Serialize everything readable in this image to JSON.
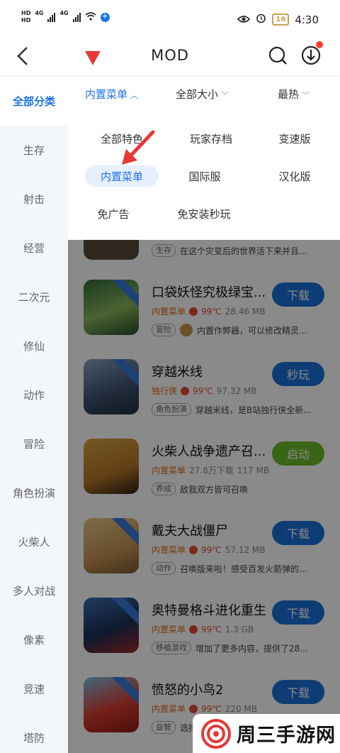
{
  "status_bar": {
    "hd_top": "HD",
    "hd_bottom": "HD",
    "net1": "4G",
    "net2": "4G",
    "net_sub1": "1",
    "net_sub2": "2",
    "battery": "16",
    "time": "4:30"
  },
  "header": {
    "title": "MOD"
  },
  "sidebar": {
    "items": [
      {
        "label": "全部分类",
        "active": true
      },
      {
        "label": "生存"
      },
      {
        "label": "射击"
      },
      {
        "label": "经营"
      },
      {
        "label": "二次元"
      },
      {
        "label": "修仙"
      },
      {
        "label": "动作"
      },
      {
        "label": "冒险"
      },
      {
        "label": "角色扮演"
      },
      {
        "label": "火柴人"
      },
      {
        "label": "多人对战"
      },
      {
        "label": "像素"
      },
      {
        "label": "竞速"
      },
      {
        "label": "塔防"
      }
    ]
  },
  "filters": [
    {
      "label": "内置菜单",
      "active": true,
      "chevron": "up"
    },
    {
      "label": "全部大小",
      "chevron": "down"
    },
    {
      "label": "最热",
      "chevron": "down"
    }
  ],
  "dropdown": {
    "options": [
      {
        "label": "全部特色"
      },
      {
        "label": "玩家存档"
      },
      {
        "label": "变速版"
      },
      {
        "label": "内置菜单",
        "active": true
      },
      {
        "label": "国际服"
      },
      {
        "label": "汉化版"
      },
      {
        "label": "免广告"
      },
      {
        "label": "免安装秒玩"
      }
    ]
  },
  "games": [
    {
      "name": "",
      "tag": "",
      "heat": "",
      "size": "",
      "category": "生存",
      "desc": "在这个灾变后的世界活下来并且...",
      "button": ""
    },
    {
      "name": "口袋妖怪究极绿宝...",
      "tag": "内置菜单",
      "heat": "99℃",
      "size": "28.46 MB",
      "category": "冒险",
      "desc": "内置作弊器，可以修改精灵...",
      "button": "下载"
    },
    {
      "name": "穿越米线",
      "tag": "独行侠",
      "heat": "99℃",
      "size": "97.32 MB",
      "category": "角色扮演",
      "desc": "穿越米线，是B站独行侠全新...",
      "button": "秒玩"
    },
    {
      "name": "火柴人战争遗产召...",
      "tag": "内置菜单",
      "heat": "27.8万下载",
      "size": "117 MB",
      "category": "养成",
      "desc": "敌我双方皆可召唤",
      "button": "启动"
    },
    {
      "name": "戴夫大战僵尸",
      "tag": "内置菜单",
      "heat": "99℃",
      "size": "57.12 MB",
      "category": "动作",
      "desc": "召唤版来啦！感受百发火箭弹的...",
      "button": "下载"
    },
    {
      "name": "奥特曼格斗进化重生",
      "tag": "内置菜单",
      "heat": "99℃",
      "size": "1.3 GB",
      "category": "移植游戏",
      "desc": "增加了更多内容，提供了28...",
      "button": "下载"
    },
    {
      "name": "愤怒的小鸟2",
      "tag": "内置菜单",
      "heat": "99℃",
      "size": "220 MB",
      "category": "益智",
      "desc": "选择",
      "button": "下载"
    }
  ],
  "watermark": {
    "text": "周三手游网"
  },
  "colors": {
    "accent": "#1b73e8",
    "download_button": "#1b6fd6",
    "launch_button": "#6dbb2a",
    "annotation_arrow": "#e53935"
  }
}
